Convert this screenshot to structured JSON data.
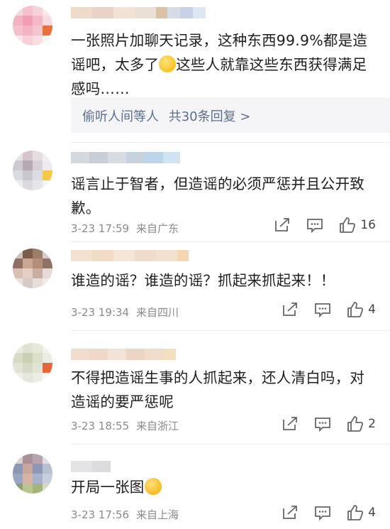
{
  "colors": {
    "link": "#5b6f8c",
    "meta": "#8a8a8a",
    "text": "#1e1e1e"
  },
  "comments": [
    {
      "text_parts": [
        "一张照片加聊天记录，这种东西99.9%都是造谣吧，太多了",
        "这些人就靠这些东西获得满足感吗……"
      ],
      "emoji": "thinking-face",
      "reply_label": "偷听人间等人",
      "reply_count": "共30条回复 >"
    },
    {
      "text": "谣言止于智者，但造谣的必须严惩并且公开致歉。",
      "date": "3-23 17:59",
      "location": "来自广东",
      "likes": "16"
    },
    {
      "text": "谁造的谣？谁造的谣？抓起来抓起来！！",
      "date": "3-23 19:34",
      "location": "来自四川",
      "likes": "4"
    },
    {
      "text": "不得把造谣生事的人抓起来，还人清白吗，对造谣的要严惩呢",
      "date": "3-23 18:55",
      "location": "来自浙江",
      "likes": "2"
    },
    {
      "text": "开局一张图",
      "emoji": "laughing-crying-face",
      "date": "3-23 17:56",
      "location": "来自上海",
      "likes": "4"
    }
  ]
}
